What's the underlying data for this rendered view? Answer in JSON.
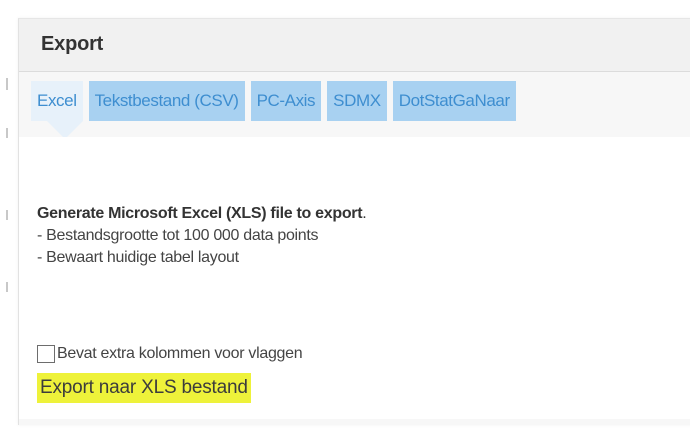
{
  "panel": {
    "title": "Export"
  },
  "tabs": [
    {
      "label": "Excel",
      "active": true
    },
    {
      "label": "Tekstbestand (CSV)",
      "active": false
    },
    {
      "label": "PC-Axis",
      "active": false
    },
    {
      "label": "SDMX",
      "active": false
    },
    {
      "label": "DotStatGaNaar",
      "active": false
    }
  ],
  "description": {
    "title_bold": "Generate Microsoft Excel (XLS) file to export",
    "title_end": ".",
    "lines": [
      "- Bestandsgrootte tot 100 000 data points",
      "- Bewaart huidige tabel layout"
    ]
  },
  "options": {
    "flags_checkbox_label": "Bevat extra kolommen voor vlaggen",
    "flags_checked": false
  },
  "actions": {
    "export_label": "Export naar XLS bestand"
  },
  "colors": {
    "tab_bg": "#a8d1f1",
    "tab_active_bg": "#e7f1fa",
    "tab_text": "#3e8ed0",
    "highlight": "#eef23a"
  }
}
